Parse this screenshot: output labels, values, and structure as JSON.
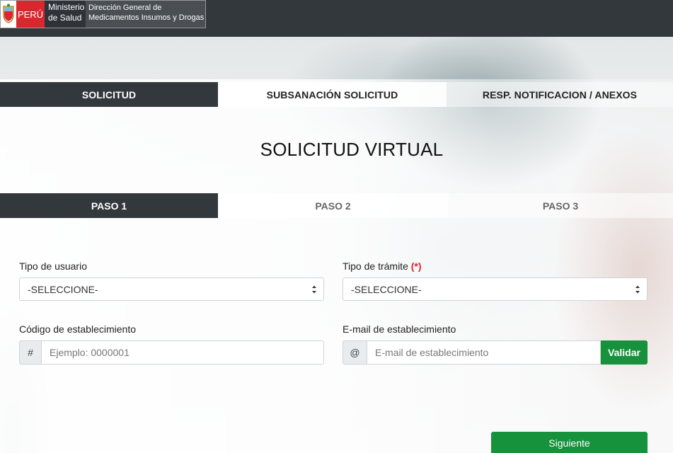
{
  "header": {
    "country": "PERÚ",
    "ministry_line1": "Ministerio",
    "ministry_line2": "de Salud",
    "agency_line1": "Dirección General de",
    "agency_line2": "Medicamentos Insumos y Drogas"
  },
  "main_tabs": [
    {
      "label": "SOLICITUD",
      "active": true
    },
    {
      "label": "SUBSANACIÓN SOLICITUD",
      "active": false
    },
    {
      "label": "RESP. NOTIFICACION / ANEXOS",
      "active": false
    }
  ],
  "page_title": "SOLICITUD VIRTUAL",
  "steps": [
    {
      "label": "PASO 1",
      "active": true
    },
    {
      "label": "PASO 2",
      "active": false
    },
    {
      "label": "PASO 3",
      "active": false
    }
  ],
  "form": {
    "tipo_usuario": {
      "label": "Tipo de usuario",
      "value": "-SELECCIONE-"
    },
    "tipo_tramite": {
      "label": "Tipo de trámite",
      "required_mark": "(*)",
      "value": "-SELECCIONE-"
    },
    "codigo": {
      "label": "Código de establecimiento",
      "prefix": "#",
      "placeholder": "Ejemplo: 0000001"
    },
    "email": {
      "label": "E-mail de establecimiento",
      "prefix": "@",
      "placeholder": "E-mail de establecimiento",
      "button": "Validar"
    }
  },
  "next_button": "Siguiente",
  "colors": {
    "header_bg": "#33383d",
    "active_tab_bg": "#33383d",
    "accent_green": "#16913c",
    "required_red": "#d9232e",
    "peru_red": "#d7282f"
  }
}
